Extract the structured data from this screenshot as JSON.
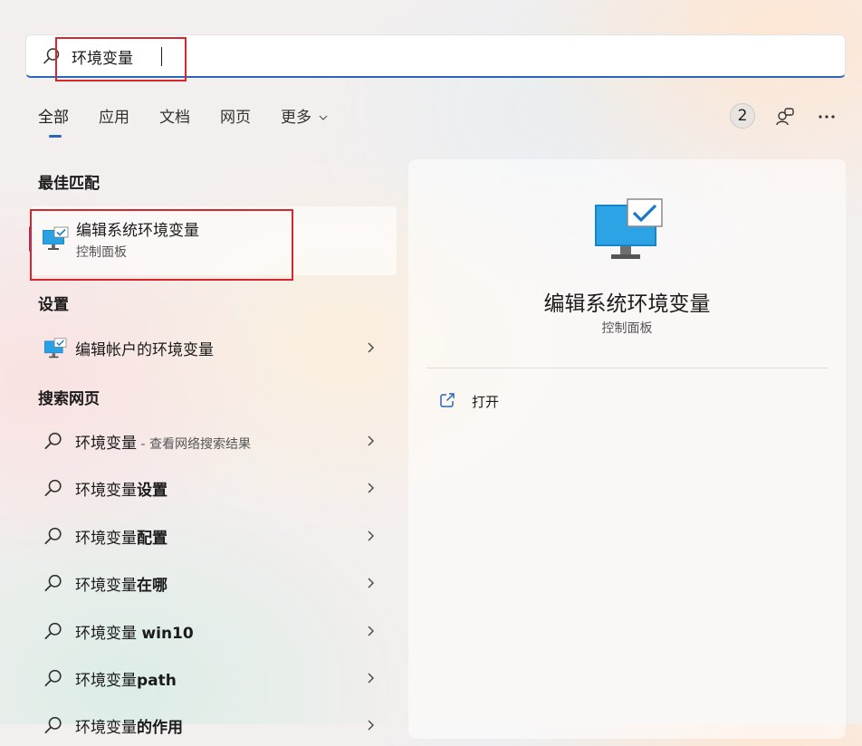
{
  "search": {
    "value": "环境变量",
    "placeholder": ""
  },
  "tabs": [
    {
      "label": "全部",
      "active": true
    },
    {
      "label": "应用"
    },
    {
      "label": "文档"
    },
    {
      "label": "网页"
    },
    {
      "label": "更多"
    }
  ],
  "header_right": {
    "badge_count": "2",
    "icons": [
      "account-switch-icon",
      "more-options-icon"
    ]
  },
  "sections": {
    "best_match": "最佳匹配",
    "settings": "设置",
    "web_search": "搜索网页"
  },
  "best_match_item": {
    "title": "编辑系统环境变量",
    "subtitle": "控制面板",
    "icon": "monitor-check-icon"
  },
  "settings_items": [
    {
      "label": "编辑帐户的环境变量",
      "icon": "monitor-check-icon"
    }
  ],
  "web_results": [
    {
      "prefix": "环境变量",
      "bold": "",
      "hint": " - 查看网络搜索结果"
    },
    {
      "prefix": "环境变量",
      "bold": "设置",
      "hint": ""
    },
    {
      "prefix": "环境变量",
      "bold": "配置",
      "hint": ""
    },
    {
      "prefix": "环境变量",
      "bold": "在哪",
      "hint": ""
    },
    {
      "prefix": "环境变量 ",
      "bold": "win10",
      "hint": ""
    },
    {
      "prefix": "环境变量",
      "bold": "path",
      "hint": ""
    },
    {
      "prefix": "环境变量",
      "bold": "的作用",
      "hint": ""
    }
  ],
  "detail": {
    "title": "编辑系统环境变量",
    "subtitle": "控制面板",
    "actions": [
      {
        "label": "打开",
        "icon": "open-external-icon"
      }
    ]
  },
  "colors": {
    "accent": "#2a65b8",
    "highlight_box": "#d9262c",
    "selection_bar": "#7a3e8e"
  }
}
